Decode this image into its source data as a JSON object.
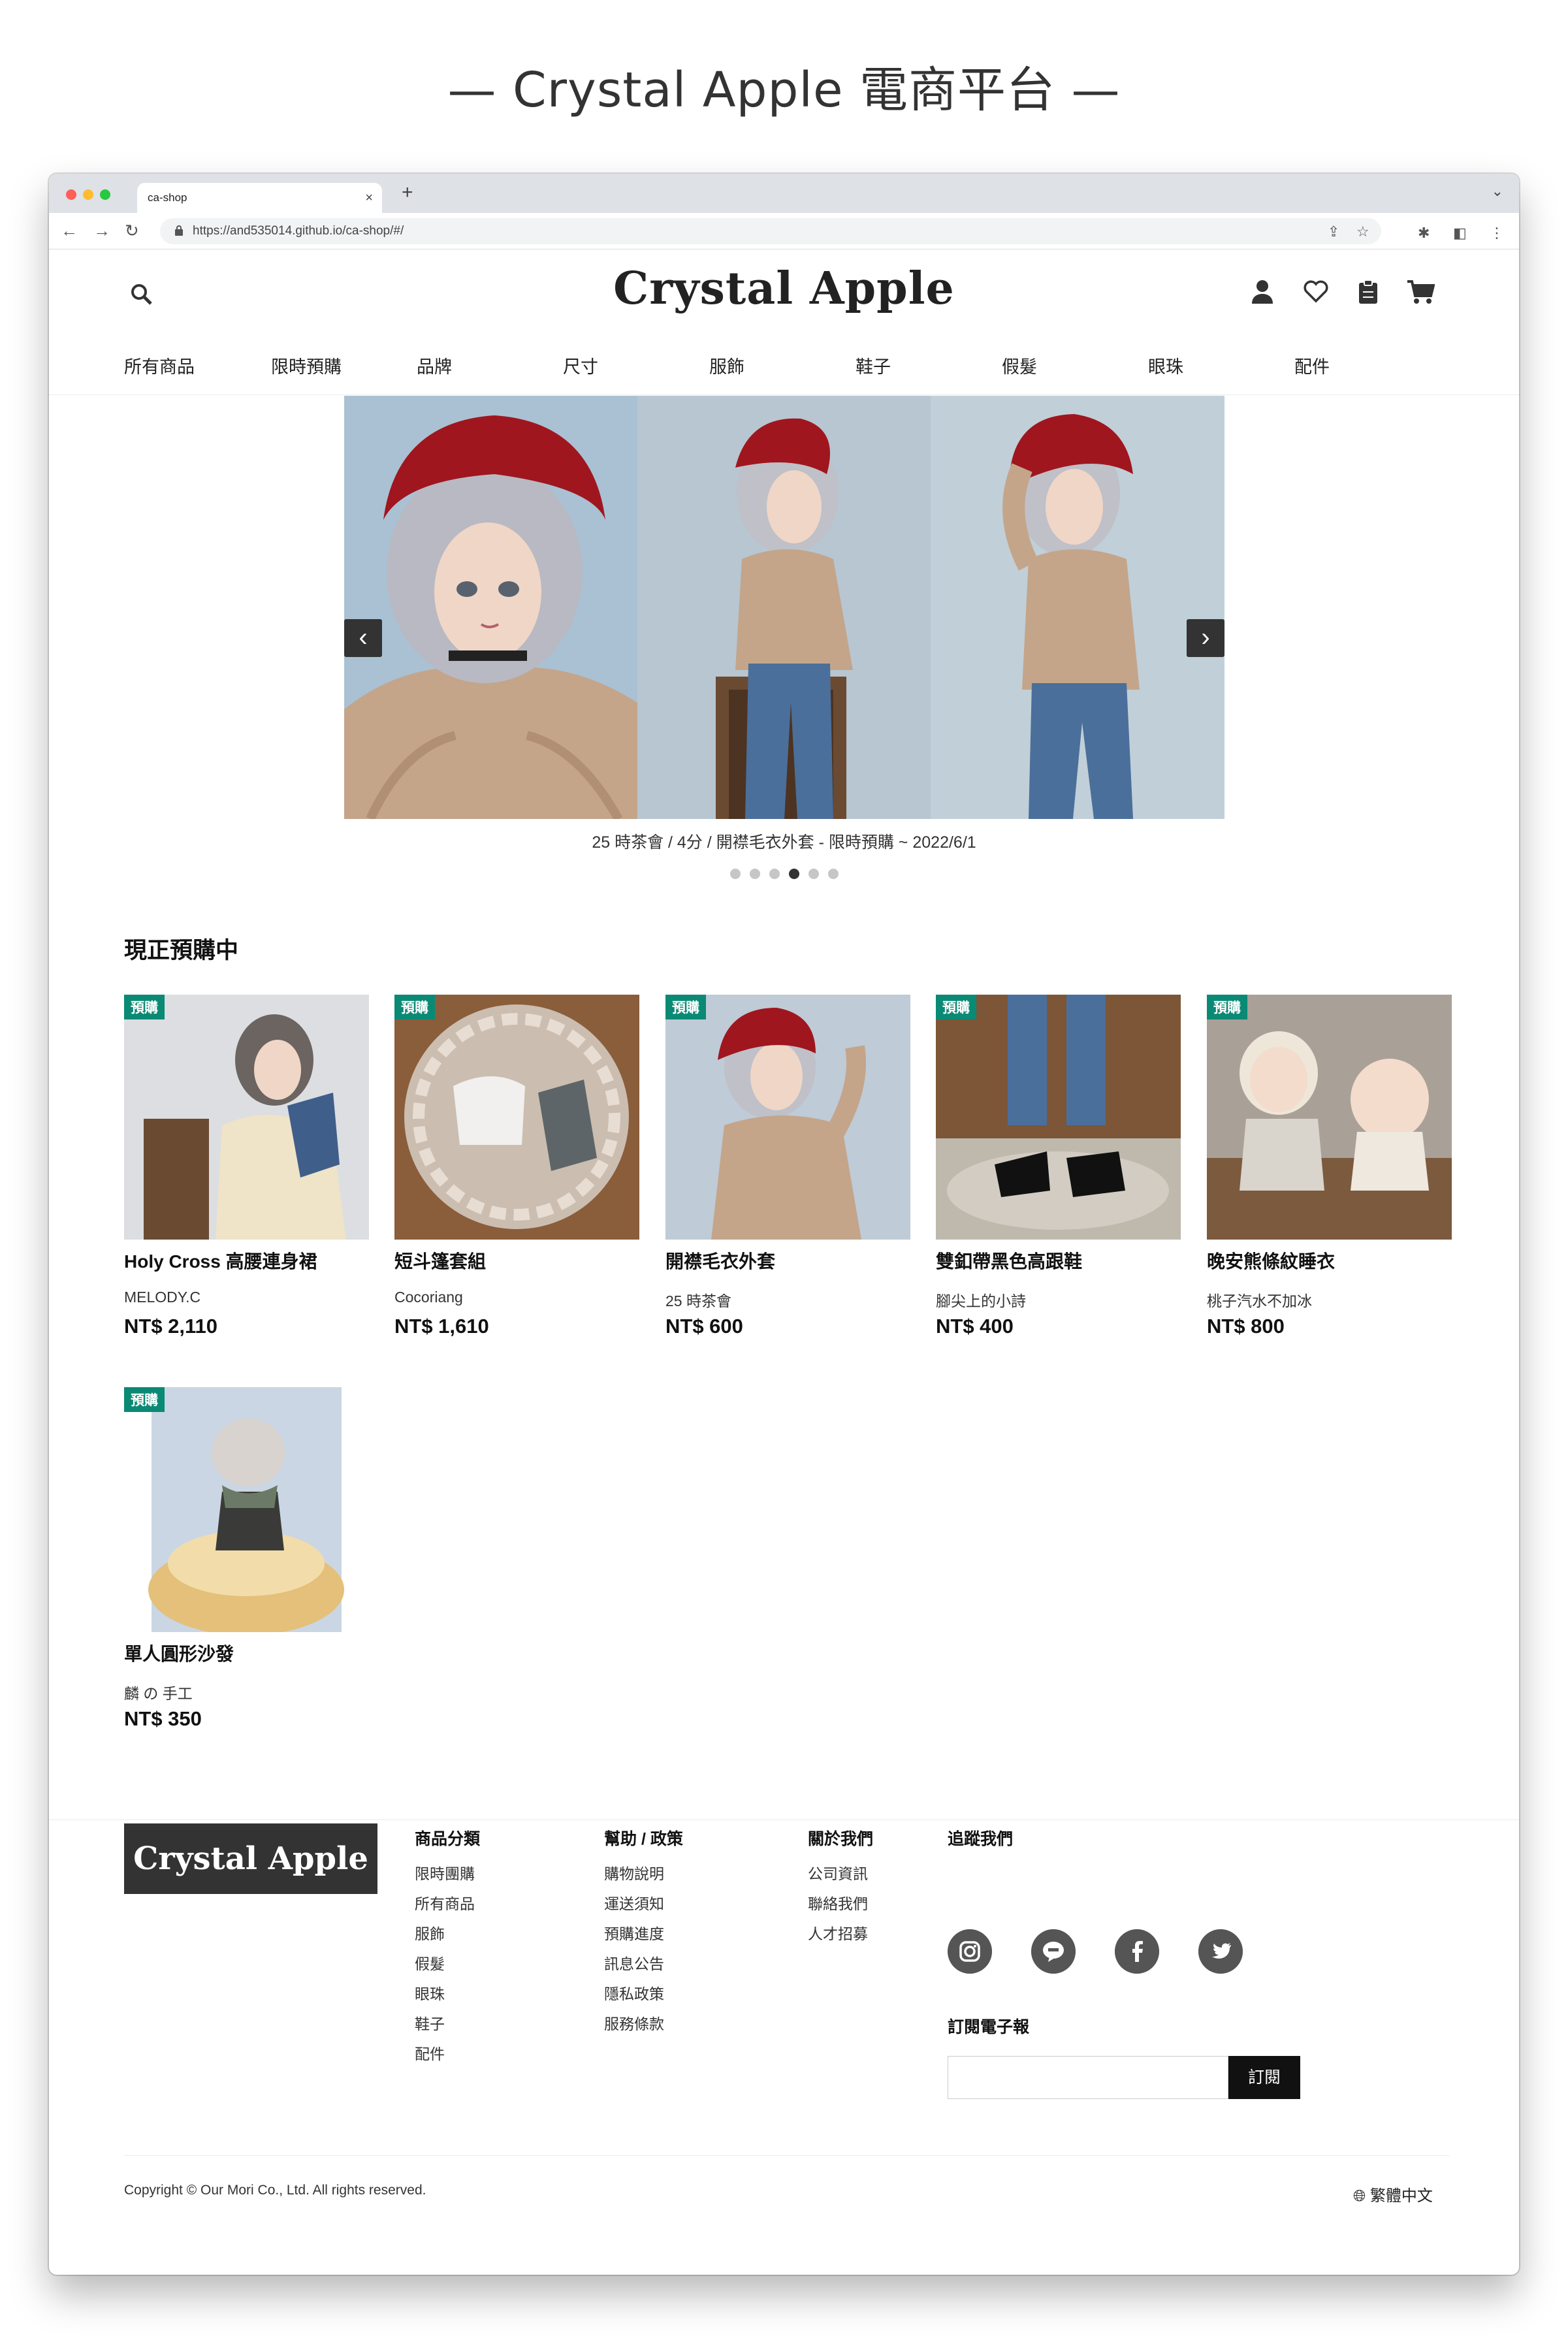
{
  "headline": "— Crystal Apple 電商平台 —",
  "browser": {
    "tab_title": "ca-shop",
    "tab_close": "×",
    "new_tab": "+",
    "url": "https://and535014.github.io/ca-shop/#/"
  },
  "header": {
    "brand": "Crystal Apple",
    "icons": [
      "search-icon",
      "user-icon",
      "heart-icon",
      "clipboard-icon",
      "cart-icon"
    ]
  },
  "nav": [
    "所有商品",
    "限時預購",
    "品牌",
    "尺寸",
    "服飾",
    "鞋子",
    "假髮",
    "眼珠",
    "配件"
  ],
  "carousel": {
    "prev": "‹",
    "next": "›",
    "caption": "25 時茶會 / 4分 / 開襟毛衣外套 - 限時預購 ~ 2022/6/1",
    "dots_total": 6,
    "active_dot": 4
  },
  "preorder": {
    "title": "現正預購中",
    "badge": "預購",
    "products": [
      {
        "name": "Holy Cross 高腰連身裙",
        "brand": "MELODY.C",
        "price": "NT$ 2,110"
      },
      {
        "name": "短斗篷套組",
        "brand": "Cocoriang",
        "price": "NT$ 1,610"
      },
      {
        "name": "開襟毛衣外套",
        "brand": "25 時茶會",
        "price": "NT$ 600"
      },
      {
        "name": "雙釦帶黑色高跟鞋",
        "brand": "腳尖上的小詩",
        "price": "NT$ 400"
      },
      {
        "name": "晚安熊條紋睡衣",
        "brand": "桃子汽水不加冰",
        "price": "NT$ 800"
      },
      {
        "name": "單人圓形沙發",
        "brand": "麟 の 手工",
        "price": "NT$ 350"
      }
    ]
  },
  "footer": {
    "logo": "Crystal Apple",
    "columns": [
      {
        "heading": "商品分類",
        "links": [
          "限時團購",
          "所有商品",
          "服飾",
          "假髮",
          "眼珠",
          "鞋子",
          "配件"
        ]
      },
      {
        "heading": "幫助 / 政策",
        "links": [
          "購物說明",
          "運送須知",
          "預購進度",
          "訊息公告",
          "隱私政策",
          "服務條款"
        ]
      },
      {
        "heading": "關於我們",
        "links": [
          "公司資訊",
          "聯絡我們",
          "人才招募"
        ]
      }
    ],
    "follow": "追蹤我們",
    "social_icons": [
      "instagram-icon",
      "line-icon",
      "facebook-icon",
      "twitter-icon"
    ],
    "newsletter": "訂閱電子報",
    "subscribe_button": "訂閱",
    "copyright": "Copyright © Our Mori Co., Ltd. All rights reserved.",
    "language": "繁體中文"
  },
  "colors": {
    "badge": "#0a8a74",
    "dark": "#333333",
    "accent_red": "#a0161e",
    "sweater": "#c4a58a",
    "wall": "#9eb9cf"
  }
}
